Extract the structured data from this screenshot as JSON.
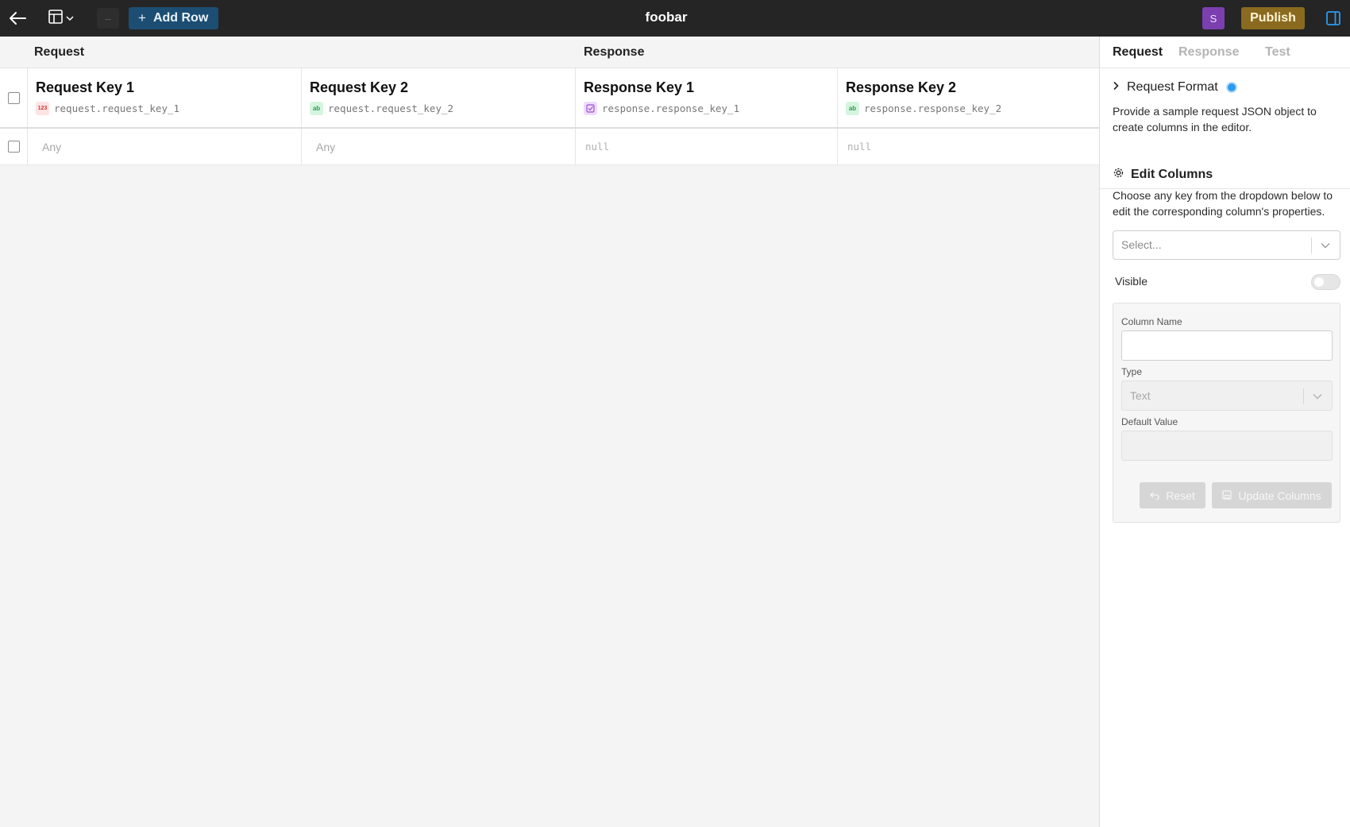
{
  "app": {
    "title": "foobar"
  },
  "toolbar": {
    "add_row_label": "Add Row",
    "minus_label": "–",
    "avatar_initial": "S",
    "publish_label": "Publish"
  },
  "groups": {
    "request": "Request",
    "response": "Response"
  },
  "columns": [
    {
      "title": "Request Key 1",
      "key": "request.request_key_1",
      "type_badge": "123",
      "type": "number",
      "cell": "Any"
    },
    {
      "title": "Request Key 2",
      "key": "request.request_key_2",
      "type_badge": "ab",
      "type": "text",
      "cell": "Any"
    },
    {
      "title": "Response Key 1",
      "key": "response.response_key_1",
      "type_badge": "check",
      "type": "boolean",
      "cell": "null"
    },
    {
      "title": "Response Key 2",
      "key": "response.response_key_2",
      "type_badge": "ab",
      "type": "text",
      "cell": "null"
    }
  ],
  "panel": {
    "tabs": [
      "Request",
      "Response",
      "Test"
    ],
    "active_tab": "Request",
    "request_format": {
      "title": "Request Format",
      "description": "Provide a sample request JSON object to create columns in the editor."
    },
    "edit_columns": {
      "title": "Edit Columns",
      "description": "Choose any key from the dropdown below to edit the corresponding column's properties.",
      "select_placeholder": "Select...",
      "visible_label": "Visible",
      "visible_on": false,
      "column_name_label": "Column Name",
      "column_name_value": "",
      "type_label": "Type",
      "type_value": "Text",
      "default_value_label": "Default Value",
      "default_value": "",
      "reset_label": "Reset",
      "update_label": "Update Columns"
    }
  },
  "icons": {
    "back": "arrow-left-icon",
    "view": "table-layout-icon",
    "panel": "sidebar-panel-icon",
    "gear": "gear-icon",
    "chevron": "chevron-down-icon"
  },
  "colors": {
    "topbar": "#252525",
    "add_row": "#1c4e73",
    "publish": "#8a6a1f",
    "avatar": "#7b3fb0",
    "info_dot": "#2b9bf0"
  }
}
